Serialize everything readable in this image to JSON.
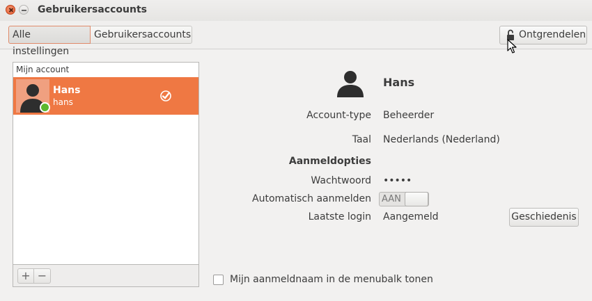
{
  "window": {
    "title": "Gebruikersaccounts",
    "controls": [
      "close-icon",
      "minimize-icon"
    ]
  },
  "toolbar": {
    "breadcrumb": [
      "Alle instellingen",
      "Gebruikersaccounts"
    ],
    "unlock_label": "Ontgrendelen",
    "unlock_icon": "lock-icon"
  },
  "accounts": {
    "header": "Mijn account",
    "users": [
      {
        "name": "Hans",
        "login": "hans",
        "status": "online",
        "selected": true
      }
    ],
    "add_label": "+",
    "remove_label": "−"
  },
  "details": {
    "name": "Hans",
    "account_type_label": "Account-type",
    "account_type": "Beheerder",
    "language_label": "Taal",
    "language": "Nederlands (Nederland)",
    "login_options_heading": "Aanmeldopties",
    "password_label": "Wachtwoord",
    "password": "•••••",
    "autologin_label": "Automatisch aanmelden",
    "autologin_state": "AAN",
    "last_login_label": "Laatste login",
    "last_login": "Aangemeld",
    "history_button": "Geschiedenis"
  },
  "footer": {
    "show_name_checkbox": "Mijn aanmeldnaam in de menubalk tonen",
    "show_name_checked": false
  },
  "colors": {
    "accent": "#ef7843",
    "online": "#5bb82f",
    "close": "#e4572a"
  }
}
